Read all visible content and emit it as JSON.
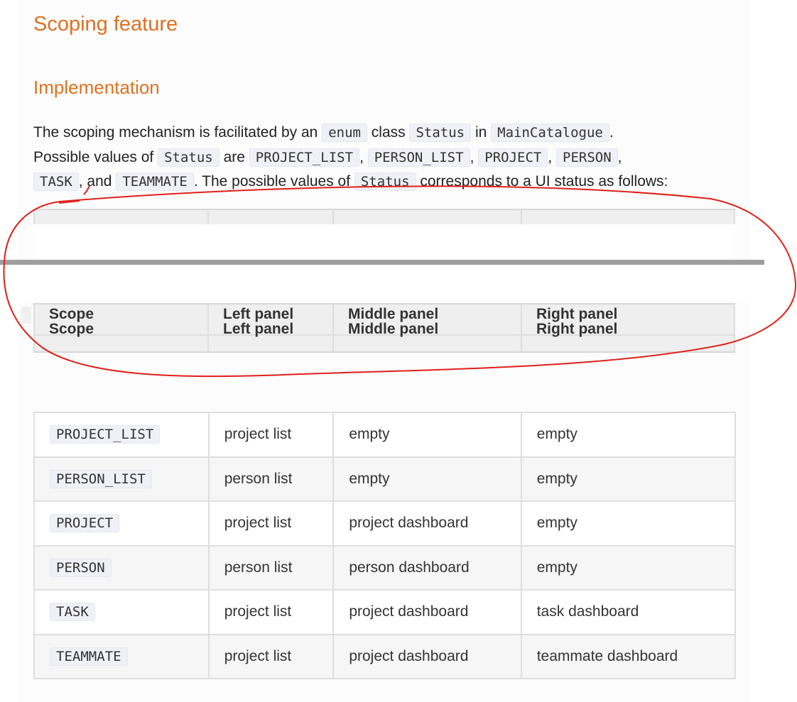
{
  "headings": {
    "title": "Scoping feature",
    "subtitle": "Implementation"
  },
  "paragraph": {
    "t1": "The scoping mechanism is facilitated by an ",
    "c1": "enum",
    "t2": " class ",
    "c2": "Status",
    "t3": " in ",
    "c3": "MainCatalogue",
    "t4": ".",
    "t5": "Possible values of ",
    "c4": "Status",
    "t6": " are ",
    "c5": "PROJECT_LIST",
    "t7": ", ",
    "c6": "PERSON_LIST",
    "t8": ", ",
    "c7": "PROJECT",
    "t9": ", ",
    "c8": "PERSON",
    "t10": ",",
    "c9": "TASK",
    "t11": ", and ",
    "c10": "TEAMMATE",
    "t12": ". The possible values of ",
    "c11": "Status",
    "t13": " corresponds to a UI status as follows:"
  },
  "table": {
    "headers": [
      "Scope",
      "Left panel",
      "Middle panel",
      "Right panel"
    ],
    "rows": [
      {
        "scope": "PROJECT_LIST",
        "left": "project list",
        "middle": "empty",
        "right": "empty"
      },
      {
        "scope": "PERSON_LIST",
        "left": "person list",
        "middle": "empty",
        "right": "empty"
      },
      {
        "scope": "PROJECT",
        "left": "project list",
        "middle": "project dashboard",
        "right": "empty"
      },
      {
        "scope": "PERSON",
        "left": "person list",
        "middle": "person dashboard",
        "right": "empty"
      },
      {
        "scope": "TASK",
        "left": "project list",
        "middle": "project dashboard",
        "right": "task dashboard"
      },
      {
        "scope": "TEAMMATE",
        "left": "project list",
        "middle": "project dashboard",
        "right": "teammate dashboard"
      }
    ]
  },
  "colors": {
    "heading": "#e07020",
    "annotation": "#e0201a"
  }
}
